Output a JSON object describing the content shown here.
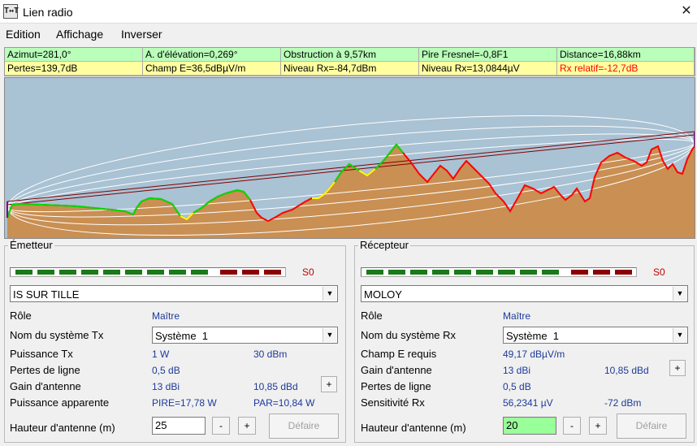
{
  "window": {
    "title": "Lien radio",
    "icon": "radio-link-icon",
    "close": "✕"
  },
  "menu": [
    "Edition",
    "Affichage",
    "Inverser"
  ],
  "info": {
    "row1": [
      "Azimut=281,0°",
      "A. d'élévation=0,269°",
      "Obstruction à 9,57km",
      "Pire Fresnel=-0,8F1",
      "Distance=16,88km"
    ],
    "row2": [
      "Pertes=139,7dB",
      "Champ E=36,5dBµV/m",
      "Niveau Rx=-84,7dBm",
      "Niveau Rx=13,0844µV",
      "Rx relatif=-12,7dB"
    ],
    "colors": {
      "row1_bg": "#b9ffb9",
      "row2_bg": "#ffffa0",
      "rx_relatif": "#ff0000"
    }
  },
  "profile": {
    "colors": {
      "sky": "#a9c2d4",
      "terrain": "#c98f53",
      "clear": "#ff0000",
      "partial": "#ffff00",
      "obstructed": "#00dd00",
      "ray": "#800000",
      "fresnel": "#ffffff"
    }
  },
  "emetteur": {
    "title": "Émetteur",
    "meter_label": "S0",
    "meter": {
      "green_segments": 9,
      "red_segments": 3,
      "green": "#1a7a1a",
      "red": "#8b0000"
    },
    "station": "IS SUR TILLE",
    "role_label": "Rôle",
    "role": "Maître",
    "system_label": "Nom du système Tx",
    "system": "Système  1",
    "rows": [
      {
        "label": "Puissance Tx",
        "v1": "1 W",
        "v2": "30 dBm"
      },
      {
        "label": "Pertes de ligne",
        "v1": "0,5 dB",
        "v2": ""
      },
      {
        "label": "Gain d'antenne",
        "v1": "13 dBi",
        "v2": "10,85 dBd"
      },
      {
        "label": "Puissance apparente",
        "v1": "PIRE=17,78 W",
        "v2": "PAR=10,84 W"
      }
    ],
    "height_label": "Hauteur d'antenne (m)",
    "height": "25",
    "minus": "-",
    "plus": "+",
    "default": "Défaire"
  },
  "recepteur": {
    "title": "Récepteur",
    "meter_label": "S0",
    "meter": {
      "green_segments": 9,
      "red_segments": 3,
      "green": "#1a7a1a",
      "red": "#8b0000"
    },
    "station": "MOLOY",
    "role_label": "Rôle",
    "role": "Maître",
    "system_label": "Nom du système Rx",
    "system": "Système  1",
    "rows": [
      {
        "label": "Champ E requis",
        "v1": "49,17 dBµV/m",
        "v2": ""
      },
      {
        "label": "Gain d'antenne",
        "v1": "13 dBi",
        "v2": "10,85 dBd"
      },
      {
        "label": "Pertes de ligne",
        "v1": "0,5 dB",
        "v2": ""
      },
      {
        "label": "Sensitivité Rx",
        "v1": "56,2341 µV",
        "v2": "-72 dBm"
      }
    ],
    "height_label": "Hauteur d'antenne (m)",
    "height": "20",
    "height_bg": "#99ff99",
    "minus": "-",
    "plus": "+",
    "default": "Défaire"
  }
}
